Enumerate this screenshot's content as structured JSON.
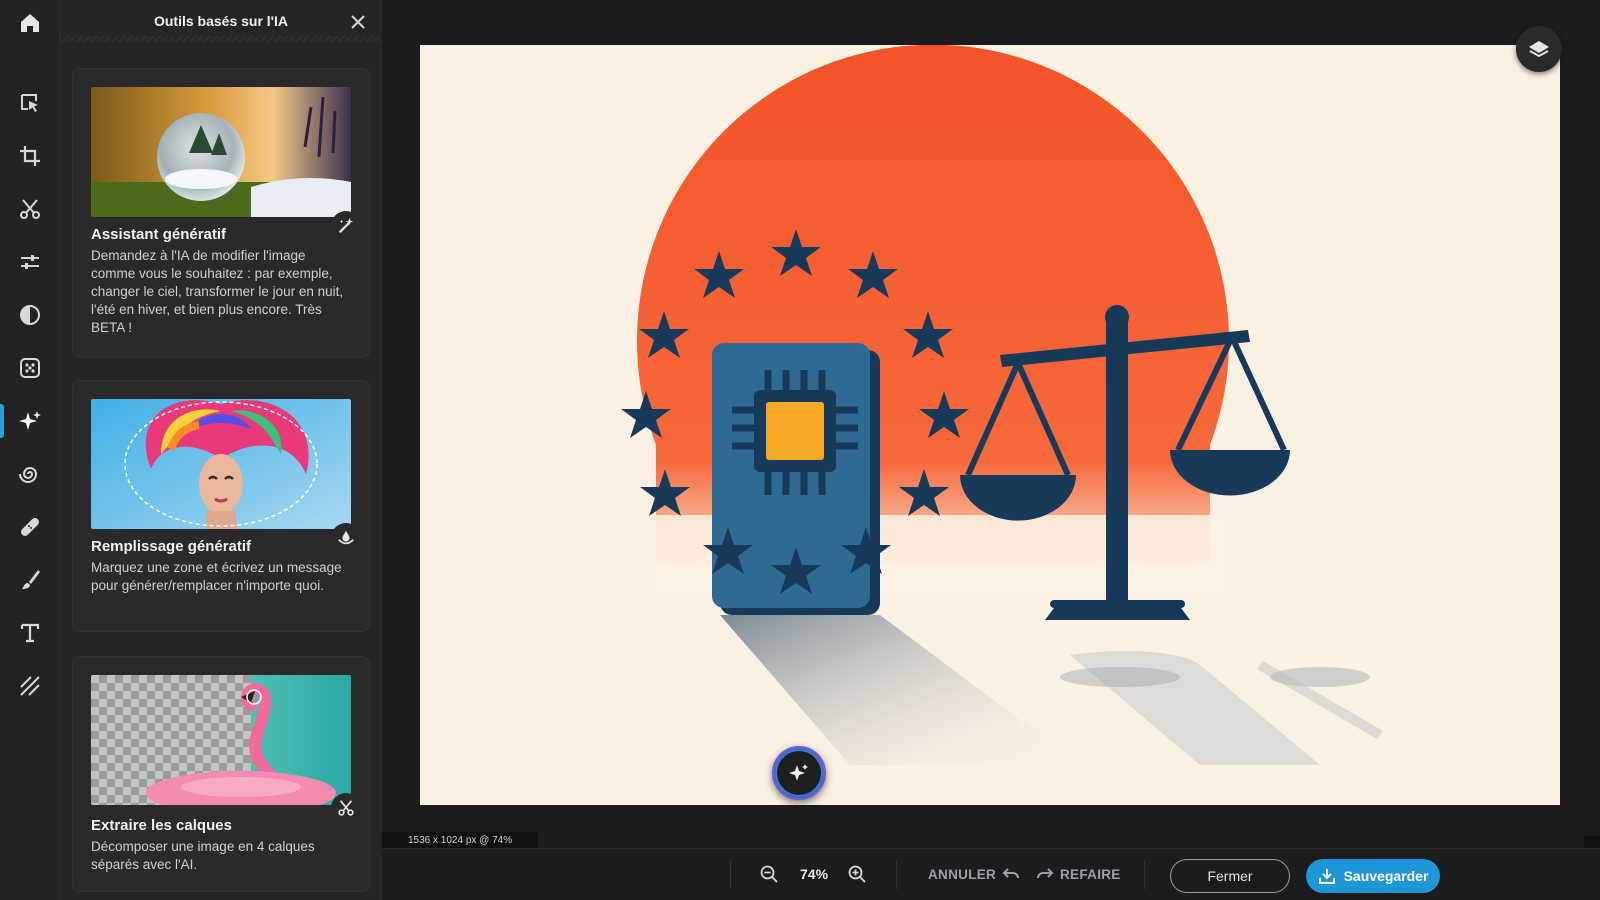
{
  "panel": {
    "title": "Outils basés sur l'IA",
    "cards": [
      {
        "title": "Assistant génératif",
        "description": "Demandez à l'IA de modifier l'image comme vous le souhaitez : par exemple, changer le ciel, transformer le jour en nuit, l'été en hiver, et bien plus encore. Très BETA !",
        "badge_icon": "magic-wand-icon"
      },
      {
        "title": "Remplissage génératif",
        "description": "Marquez une zone et écrivez un message pour générer/remplacer n'importe quoi.",
        "badge_icon": "fill-drop-icon"
      },
      {
        "title": "Extraire les calques",
        "description": "Décomposer une image en 4 calques séparés avec l'AI.",
        "badge_icon": "scissors-icon"
      }
    ]
  },
  "rail": {
    "items": [
      "home-icon",
      "select-icon",
      "crop-icon",
      "cut-icon",
      "adjust-icon",
      "contrast-icon",
      "filters-icon",
      "ai-sparkle-icon",
      "spiral-icon",
      "bandage-icon",
      "brush-icon",
      "text-icon",
      "texture-icon"
    ],
    "active": "ai-sparkle-icon"
  },
  "canvas": {
    "dimensions_label": "1536 x 1024 px @ 74%",
    "background": "#fbf1e3",
    "sun_color": "#f4572b",
    "navy_color": "#183a5a",
    "card_color": "#2f6a92",
    "chip_color": "#f7a928"
  },
  "toolbar": {
    "zoom": "74%",
    "undo_label": "ANNULER",
    "redo_label": "REFAIRE",
    "close_label": "Fermer",
    "save_label": "Sauvegarder",
    "accent": "#1f96d8"
  }
}
